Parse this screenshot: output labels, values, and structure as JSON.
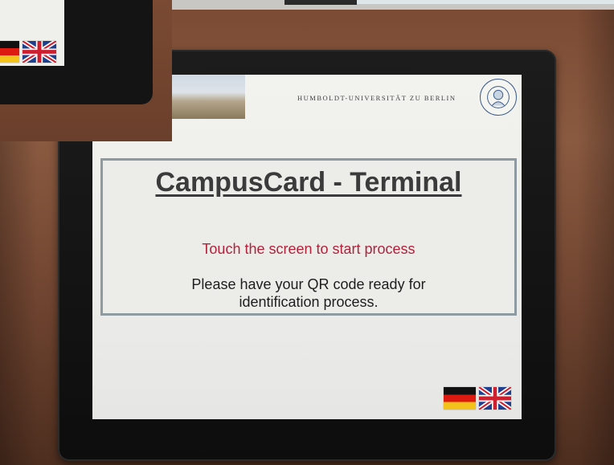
{
  "screen": {
    "university_name": "HUMBOLDT-UNIVERSITÄT ZU BERLIN",
    "title": "CampusCard - Terminal",
    "touch_prompt": "Touch the screen to start process",
    "instruction": "Please have your QR code ready for identification process.",
    "languages": [
      {
        "name": "german-flag-icon",
        "code": "de"
      },
      {
        "name": "uk-flag-icon",
        "code": "en"
      }
    ]
  },
  "colors": {
    "prompt_red": "#b2223a",
    "box_border": "#8d9aa2",
    "seal_blue": "#3b5b8a"
  }
}
